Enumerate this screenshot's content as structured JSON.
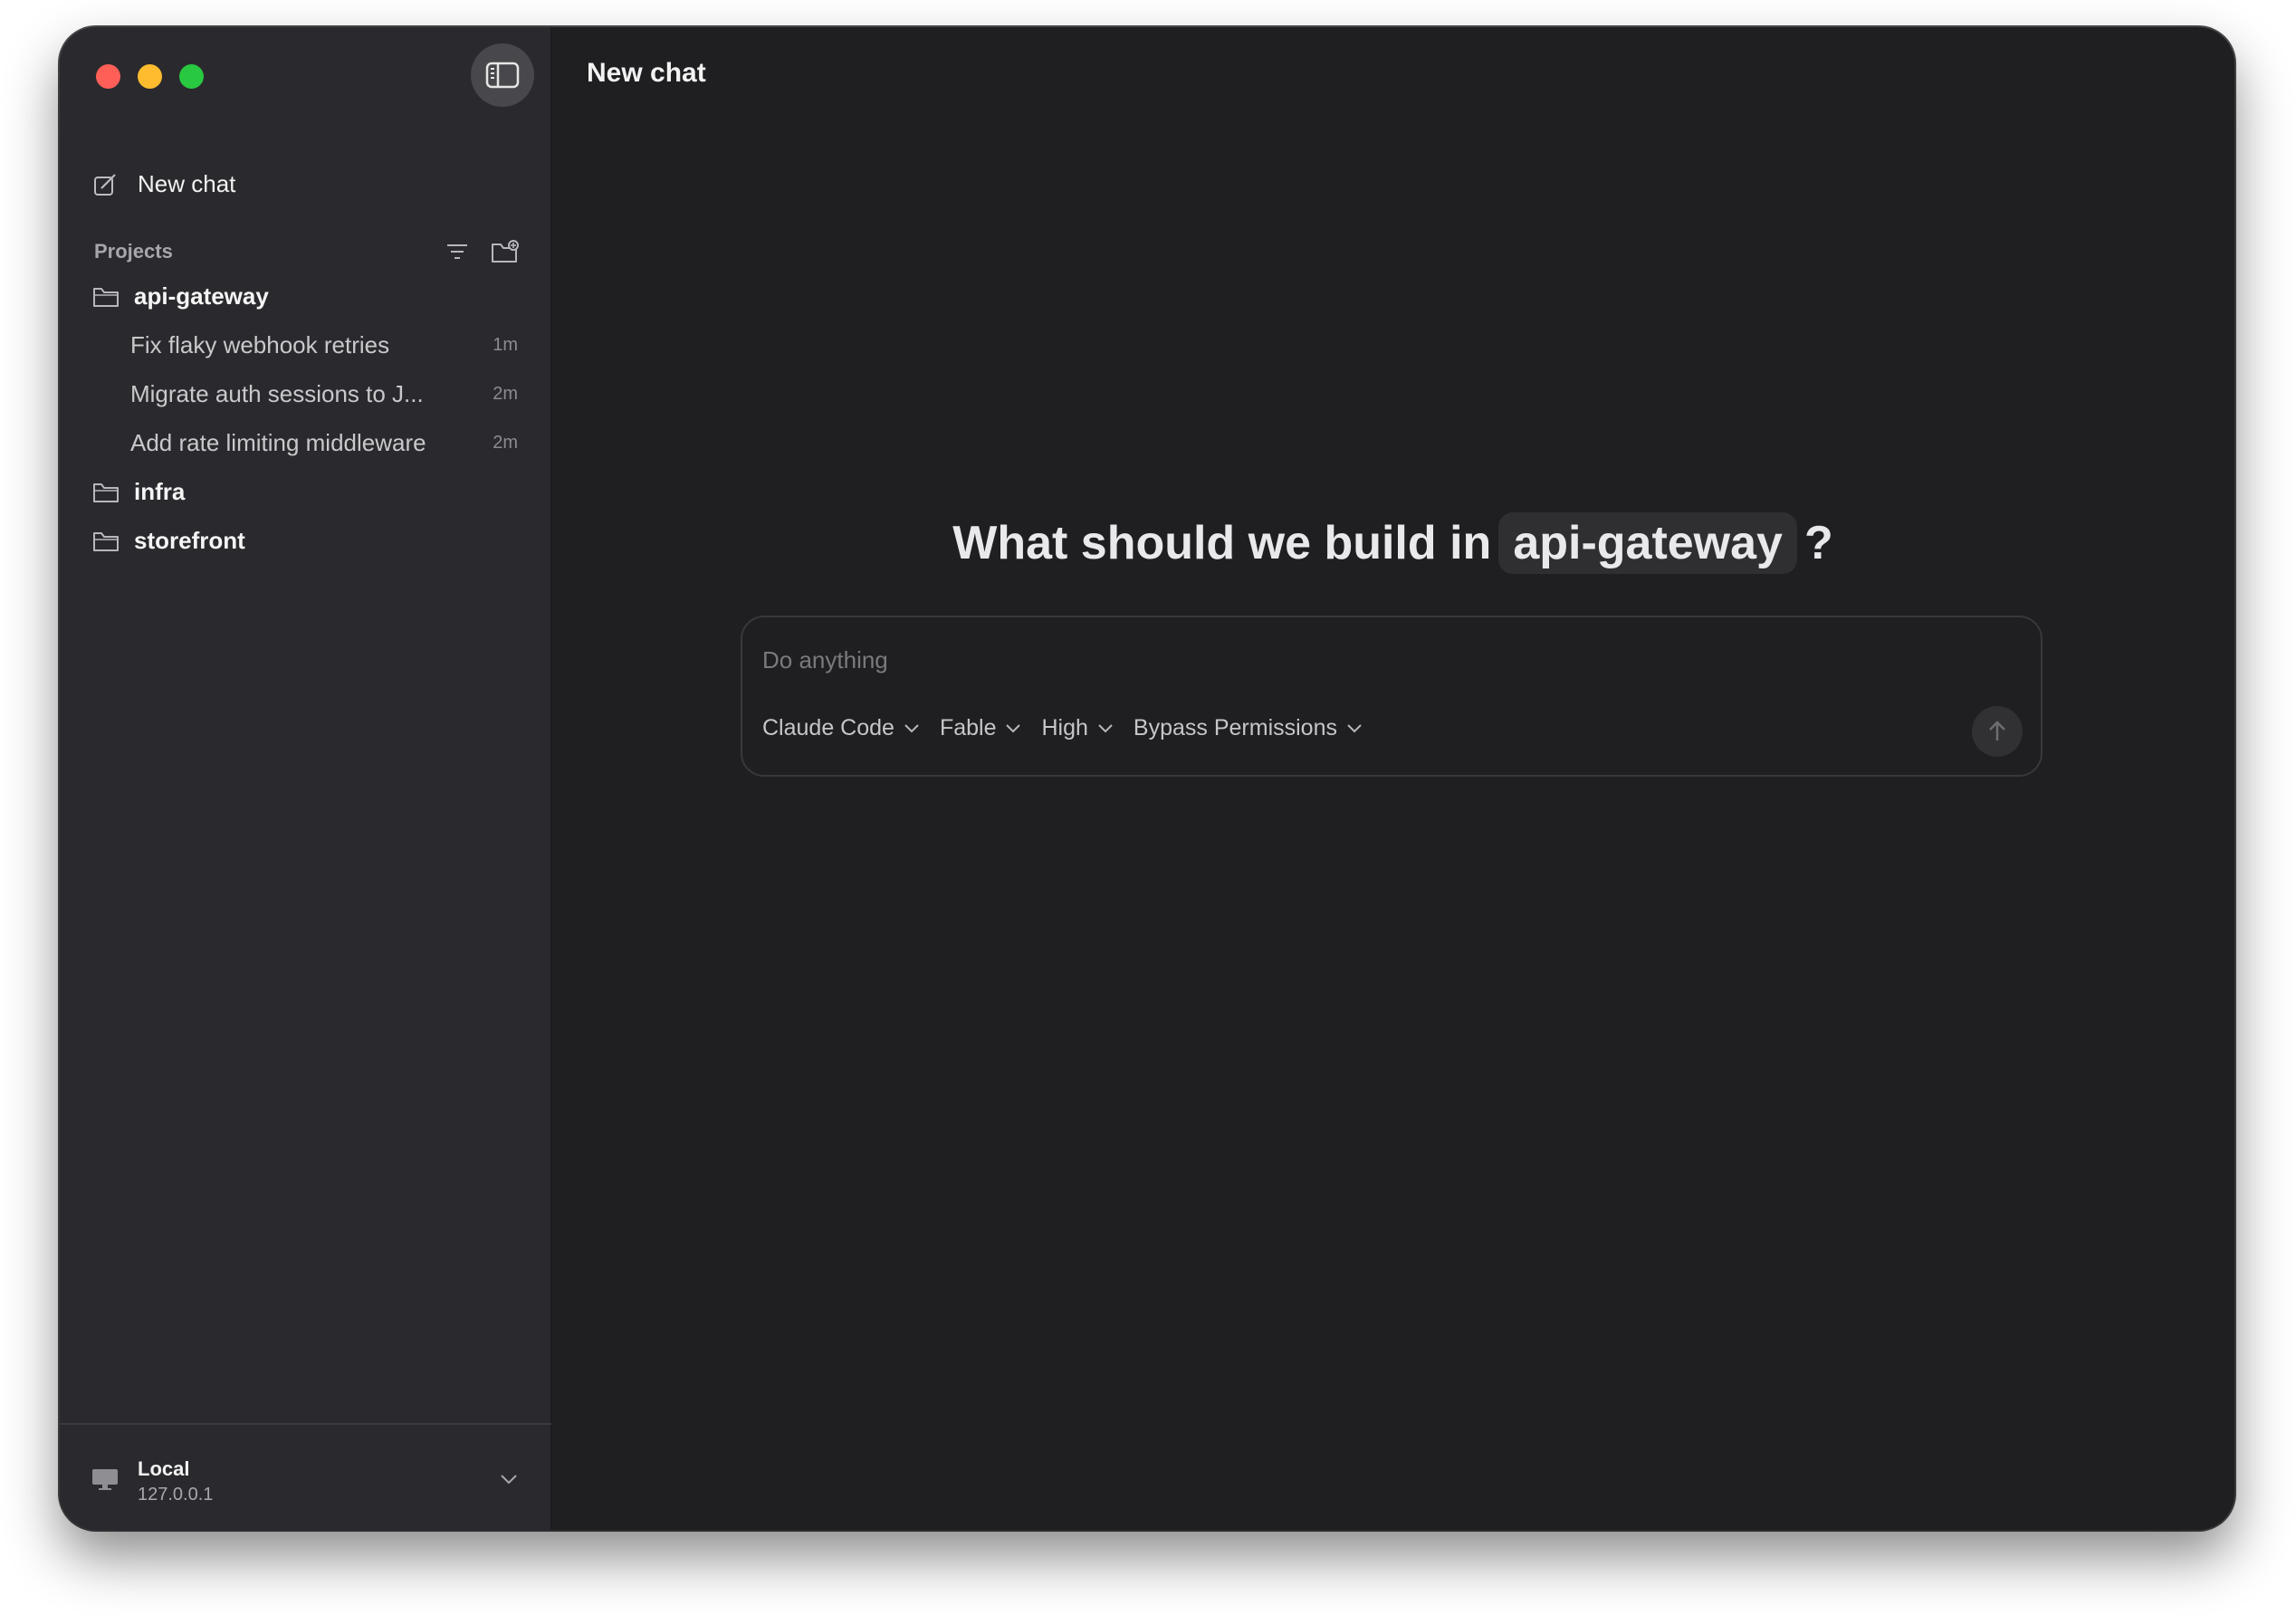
{
  "sidebar": {
    "new_chat_label": "New chat",
    "projects_title": "Projects",
    "projects": [
      {
        "name": "api-gateway",
        "chats": [
          {
            "title": "Fix flaky webhook retries",
            "time": "1m"
          },
          {
            "title": "Migrate auth sessions to J...",
            "time": "2m"
          },
          {
            "title": "Add rate limiting middleware",
            "time": "2m"
          }
        ]
      },
      {
        "name": "infra"
      },
      {
        "name": "storefront"
      }
    ],
    "footer": {
      "title": "Local",
      "subtitle": "127.0.0.1"
    }
  },
  "main": {
    "title": "New chat",
    "hero_prefix": "What should we build in",
    "hero_project": "api-gateway",
    "hero_suffix": "?",
    "composer": {
      "placeholder": "Do anything",
      "dropdowns": [
        {
          "label": "Claude Code"
        },
        {
          "label": "Fable"
        },
        {
          "label": "High"
        },
        {
          "label": "Bypass Permissions"
        }
      ]
    }
  },
  "colors": {
    "window_bg": "#1f1f21",
    "sidebar_bg": "#2a2a2e",
    "traffic_red": "#ff5f57",
    "traffic_yellow": "#febc2e",
    "traffic_green": "#28c840"
  },
  "icons": [
    "sidebar-toggle-icon",
    "compose-icon",
    "filter-icon",
    "new-folder-icon",
    "folder-icon",
    "monitor-icon",
    "chevron-down-icon",
    "arrow-up-icon"
  ]
}
